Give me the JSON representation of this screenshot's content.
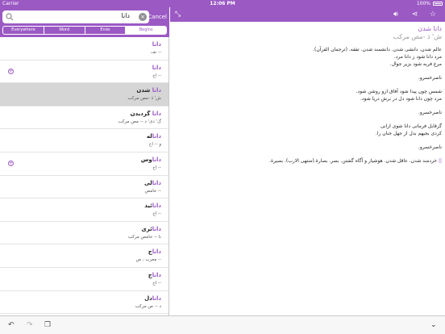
{
  "status": {
    "carrier": "Carrier",
    "time": "12:06 PM",
    "battery": "100%"
  },
  "search": {
    "value": "دانا",
    "cancel_label": "Cancel"
  },
  "segments": [
    "Everywhere",
    "Word",
    "Ends",
    "Begins"
  ],
  "results": [
    {
      "hl": "دانا",
      "rest": "",
      "sub": "-- نف",
      "add": false,
      "selected": false
    },
    {
      "hl": "دانا",
      "rest": "",
      "sub": "-- اخ",
      "add": true,
      "selected": false
    },
    {
      "hl": "دانا",
      "rest": " شدن",
      "sub": "ش' دَ -مص مرکب",
      "add": false,
      "selected": true
    },
    {
      "hl": "دانا",
      "rest": " گردیدن",
      "sub": "گ' دی' د -- مص مرکب",
      "add": false,
      "selected": false
    },
    {
      "hl": "دانا",
      "rest": "له",
      "sub": "ﻭ -- اخ",
      "add": false,
      "selected": false
    },
    {
      "hl": "دانا",
      "rest": "وس",
      "sub": "-- اخ",
      "add": true,
      "selected": false
    },
    {
      "hl": "دانا",
      "rest": "لی",
      "sub": "-- حامص",
      "add": false,
      "selected": false
    },
    {
      "hl": "دانا",
      "rest": "ئید",
      "sub": "-- اخ",
      "add": false,
      "selected": false
    },
    {
      "hl": "دانا",
      "rest": "ئری",
      "sub": "نا -- حامص مرکب",
      "add": false,
      "selected": false
    },
    {
      "hl": "دانا",
      "rest": "ج",
      "sub": "-- معرب ، ص",
      "add": false,
      "selected": false
    },
    {
      "hl": "دانا",
      "rest": "ج",
      "sub": "-- اخ",
      "add": false,
      "selected": false
    },
    {
      "hl": "دانا",
      "rest": "دل",
      "sub": "د -- ص مرکب",
      "add": false,
      "selected": false
    }
  ],
  "entry": {
    "title": "دانا شدن",
    "pronunciation": "ش' دَ -مص مرکب",
    "paragraphs": [
      [
        "عالم شدن. دانشی شدن. دانشمند شدن. تفقه. (ترجمان القرآن).",
        "مرد دانا شود ز دانا مرد.",
        "مرغ فربه شود بزیر جوال."
      ],
      [
        "ناصرخسرو."
      ],
      [
        "شمس چون پیدا شود آفاق ازو روشن شود.",
        "مرد چون دانا شود دل در برش دریا شود."
      ],
      [
        "ناصرخسرو."
      ],
      [
        "گرقابل فرمانی دانا شوی ازانی",
        "کردی بجیهم بدل از جهل جنان را."
      ],
      [
        "ناصرخسرو."
      ]
    ],
    "last_line": "خردمند شدن. عاقل شدن. هوشیار و آگاه گشتن. بصر. بصارة.(منتهی الارب). بصیرة.",
    "last_marker": "||"
  },
  "icons": {
    "search": "search-icon",
    "clear": "clear-icon",
    "expand": "expand-icon",
    "speaker": "speaker-icon",
    "share": "share-icon",
    "star": "star-icon",
    "back": "back-icon",
    "forward": "forward-icon",
    "copy": "copy-icon",
    "chevron": "chevron-down-icon",
    "add": "add-circle-icon"
  },
  "colors": {
    "accent": "#9b59c4",
    "selected_row": "#d6d6d6"
  }
}
